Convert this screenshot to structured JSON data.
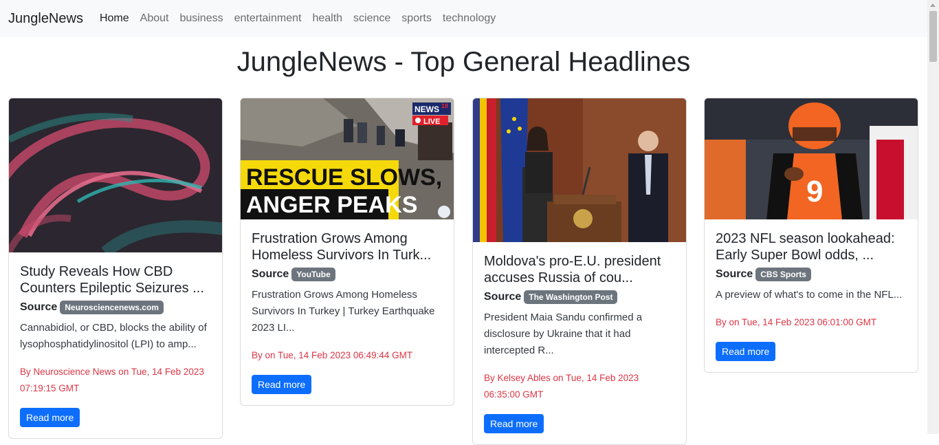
{
  "navbar": {
    "brand": "JungleNews",
    "links": [
      "Home",
      "About",
      "business",
      "entertainment",
      "health",
      "science",
      "sports",
      "technology"
    ]
  },
  "page_title": "JungleNews - Top General Headlines",
  "source_label": "Source",
  "read_more_label": "Read more",
  "cards": [
    {
      "image_text_1": "",
      "image_text_2": "",
      "title": "Study Reveals How CBD Counters Epileptic Seizures ...",
      "source": "Neurosciencenews.com",
      "text": "Cannabidiol, or CBD, blocks the ability of lysophosphatidylinositol (LPI) to amp...",
      "byline": "By Neuroscience News on Tue, 14 Feb 2023 07:19:15 GMT"
    },
    {
      "image_text_1": "RESCUE SLOWS,",
      "image_text_2": "ANGER PEAKS",
      "logo_text": "NEWS",
      "logo_num": "18",
      "live_text": "LIVE",
      "title": "Frustration Grows Among Homeless Survivors In Turk...",
      "source": "YouTube",
      "text": "Frustration Grows Among Homeless Survivors In Turkey | Turkey Earthquake 2023 LI...",
      "byline": "By on Tue, 14 Feb 2023 06:49:44 GMT"
    },
    {
      "title": "Moldova's pro-E.U. president accuses Russia of cou...",
      "source": "The Washington Post",
      "text": "President Maia Sandu confirmed a disclosure by Ukraine that it had intercepted R...",
      "byline": "By Kelsey Ables on Tue, 14 Feb 2023 06:35:00 GMT"
    },
    {
      "jersey_number": "9",
      "title": "2023 NFL season lookahead: Early Super Bowl odds, ...",
      "source": "CBS Sports",
      "text": "A preview of what's to come in the NFL...",
      "byline": "By on Tue, 14 Feb 2023 06:01:00 GMT"
    }
  ]
}
